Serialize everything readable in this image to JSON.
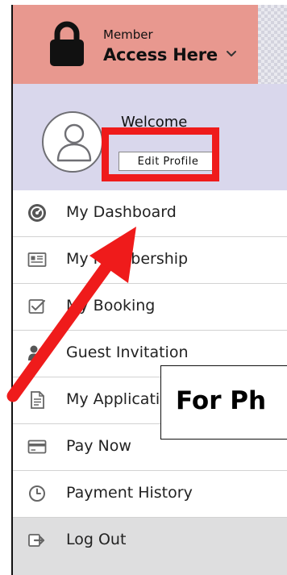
{
  "top_fragment": {
    "left_glyph": "",
    "right_glyph": ""
  },
  "header": {
    "member_label": "Member",
    "access_label": "Access Here",
    "background_color": "#e8988f"
  },
  "welcome_panel": {
    "welcome_label": "Welcome",
    "edit_profile_label": "Edit Profile",
    "background_color": "#d9d7ec"
  },
  "menu": {
    "items": [
      {
        "label": "My Dashboard",
        "icon": "dashboard-gauge-icon"
      },
      {
        "label": "My Membership",
        "icon": "membership-card-icon"
      },
      {
        "label": "My Booking",
        "icon": "booking-check-icon"
      },
      {
        "label": "Guest Invitation",
        "icon": "guest-invitation-icon"
      },
      {
        "label": "My Applications",
        "icon": "document-icon"
      },
      {
        "label": "Pay Now",
        "icon": "credit-card-icon"
      },
      {
        "label": "Payment History",
        "icon": "clock-icon"
      },
      {
        "label": "Log Out",
        "icon": "logout-arrow-icon"
      }
    ]
  },
  "annotations": {
    "callout_text": "For Ph",
    "annotation_color": "#ef1b1b"
  }
}
